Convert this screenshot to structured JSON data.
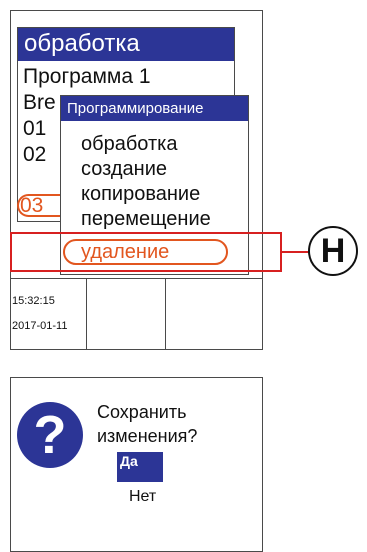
{
  "screen": {
    "panel_title": "обработка",
    "program_list": [
      "Программа 1",
      "Bre",
      "01",
      "02",
      "03"
    ],
    "time": "15:32:15",
    "date": "2017-01-11"
  },
  "menu": {
    "title": "Программирование",
    "items": [
      "обработка",
      "создание",
      "копирование",
      "перемещение",
      "удаление"
    ]
  },
  "callout": {
    "label": "H"
  },
  "dialog": {
    "question_line1": "Сохранить",
    "question_line2": "изменения?",
    "yes_label": "Да",
    "no_label": "Нет",
    "icon": "question-icon"
  },
  "colors": {
    "header_blue": "#2c3596",
    "highlight_orange": "#e2561f",
    "callout_red": "#d72020"
  }
}
